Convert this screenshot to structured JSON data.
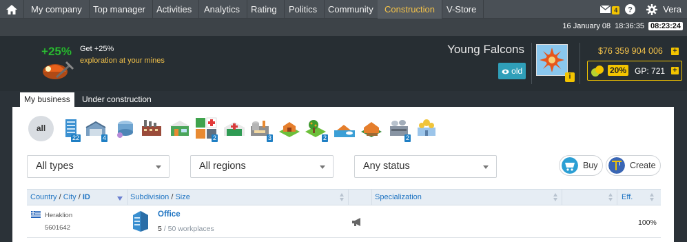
{
  "nav": {
    "home_icon": "home-icon",
    "items": [
      "My company",
      "Top manager",
      "Activities",
      "Analytics",
      "Rating",
      "Politics",
      "Community",
      "Construction",
      "V-Store"
    ],
    "active": "Construction",
    "mail_count": "4",
    "user": "Vera"
  },
  "datebar": {
    "date": "16 January 08",
    "time": "18:36:35",
    "clock": "08:23:24"
  },
  "promo": {
    "pct": "+25%",
    "title": "Get +25%",
    "subtitle": "exploration at your mines"
  },
  "company": {
    "name": "Young Falcons",
    "age_badge": "old",
    "info": "i"
  },
  "wallet": {
    "money": "$76 359 904 006",
    "gp_pct": "20%",
    "gp_label": "GP:",
    "gp_value": "721"
  },
  "tabs": {
    "my_business": "My business",
    "under_construction": "Under construction"
  },
  "categories": {
    "all": "all",
    "counts": [
      "22",
      "4",
      "2",
      "3",
      "2",
      "2"
    ]
  },
  "filters": {
    "types": "All types",
    "regions": "All regions",
    "status": "Any status"
  },
  "actions": {
    "buy": "Buy",
    "create": "Create"
  },
  "table": {
    "country": "Country",
    "city": "City",
    "id": "ID",
    "slash": "/",
    "subdivision": "Subdivision",
    "size": "Size",
    "specialization": "Specialization",
    "eff": "Eff.",
    "rows": [
      {
        "city": "Heraklion",
        "id": "5601642",
        "name": "Office",
        "size": "5",
        "capacity": "/ 50 workplaces",
        "eff": "100%"
      }
    ]
  },
  "colors": {
    "accent": "#f3c24a",
    "link": "#1f74c2",
    "nav_bg": "#4a5056",
    "header_bg": "#272e33"
  }
}
